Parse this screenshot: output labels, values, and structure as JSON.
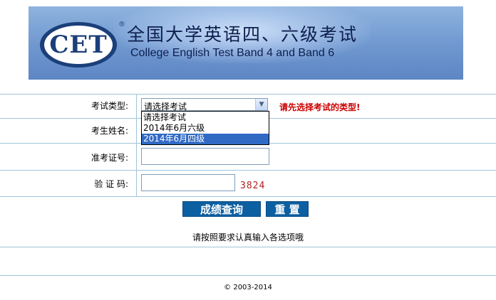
{
  "banner": {
    "logo": "CET",
    "reg_mark": "®",
    "title_cn": "全国大学英语四、六级考试",
    "title_en": "College English Test Band 4 and Band 6"
  },
  "form": {
    "exam_type_label": "考试类型:",
    "name_label": "考生姓名:",
    "ticket_label": "准考证号:",
    "captcha_label": "验 证 码:",
    "select_value": "请选择考试",
    "options": [
      "请选择考试",
      "2014年6月六级",
      "2014年6月四级"
    ],
    "highlighted_option_index": 2,
    "hint": "请先选择考试的类型!",
    "name_value": "",
    "ticket_value": "",
    "captcha_input_value": "",
    "captcha_code": "3824",
    "query_button": "成绩查询",
    "reset_button": "重 置",
    "note": "请按照要求认真输入各选项哦"
  },
  "footer": {
    "copyright": "© 2003-2014"
  },
  "colors": {
    "line": "#9ec4db",
    "hint": "#cc0000",
    "button": "#0c5fa1",
    "highlight": "#316ac5"
  },
  "icons": {
    "select_arrow": "chevron-down-icon"
  }
}
